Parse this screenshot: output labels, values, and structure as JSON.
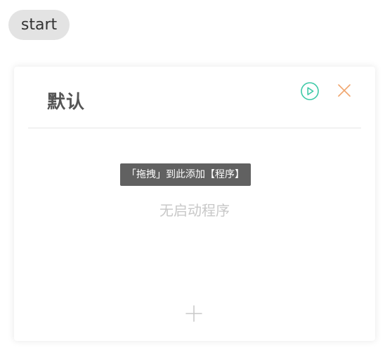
{
  "start_button": {
    "label": "start"
  },
  "group": {
    "title": "默认",
    "drag_tip": "「拖拽」到此添加【程序】",
    "empty_text": "无启动程序"
  },
  "icons": {
    "run": "play-circle-icon",
    "close": "close-icon",
    "add": "plus-icon"
  },
  "colors": {
    "run_icon": "#3ec9a7",
    "close_icon": "#f0a56d",
    "add_icon": "#c9c9c9",
    "tip_bg": "#616161"
  }
}
